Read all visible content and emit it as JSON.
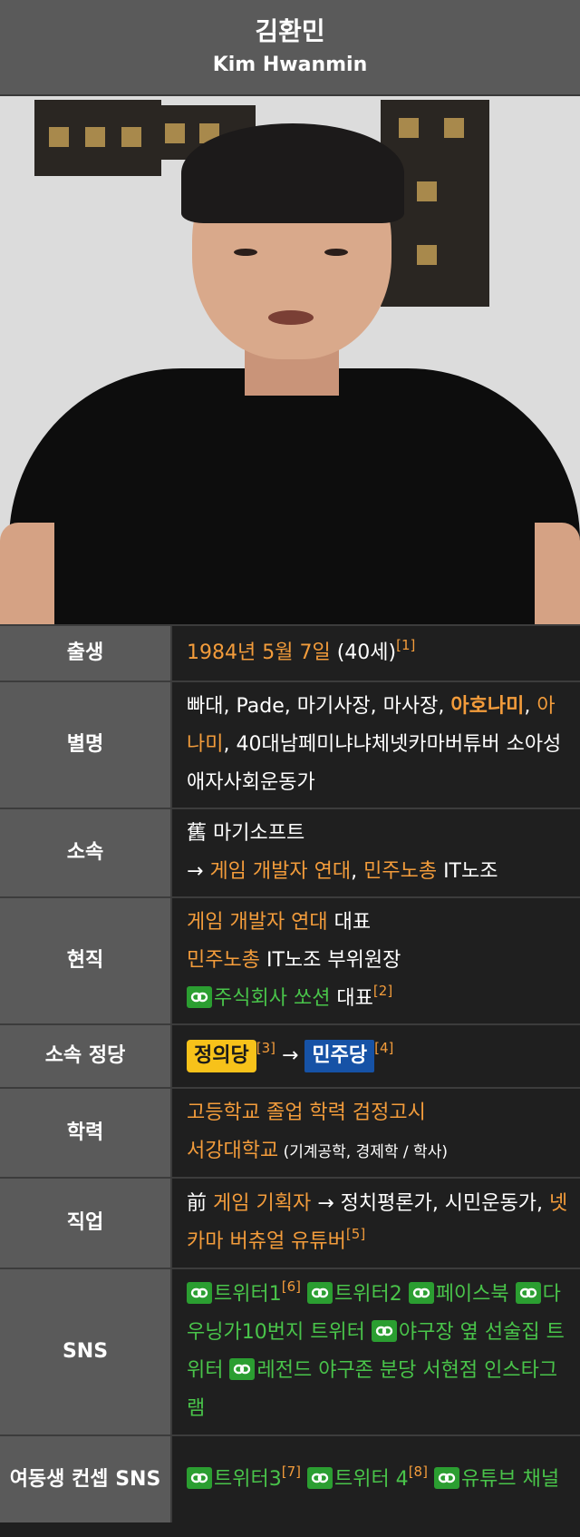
{
  "header": {
    "name_ko": "김환민",
    "name_en": "Kim Hwanmin"
  },
  "rows": {
    "birth": {
      "label": "출생",
      "date": "1984년 5월 7일",
      "age": "(40세)",
      "fn": "[1]"
    },
    "alias": {
      "label": "별명",
      "t1": "빠대, Pade, 마기사장, 마사장, ",
      "l1": "아호나미",
      "t2": ",",
      "l2": "아나미",
      "t3": ", 40대남페미냐냐체넷카마버튜버 소아성애자사회운동가"
    },
    "affil": {
      "label": "소속",
      "line1": "舊 마기소프트",
      "arrow": "→ ",
      "l1": "게임 개발자 연대",
      "sep": ", ",
      "l2": "민주노총",
      "t2": " IT노조"
    },
    "current": {
      "label": "현직",
      "l1": "게임 개발자 연대",
      "t1": " 대표",
      "l2": "민주노총",
      "t2": " IT노조 부위원장",
      "l3": "주식회사 쏘션",
      "t3": " 대표",
      "fn": "[2]"
    },
    "party": {
      "label": "소속 정당",
      "p1": "정의당",
      "fn1": "[3]",
      "arrow": " → ",
      "p2": "민주당",
      "fn2": "[4]"
    },
    "edu": {
      "label": "학력",
      "l1": "고등학교 졸업 학력 검정고시",
      "l2": "서강대학교",
      "t2": " (기계공학, 경제학 / 학사)"
    },
    "job": {
      "label": "직업",
      "t1": "前 ",
      "l1": "게임 기획자",
      "t2": " → 정치평론가, 시민운동가, ",
      "l2": "넷카마 버츄얼 유튜버",
      "fn": "[5]"
    },
    "sns": {
      "label": "SNS",
      "links": [
        "트위터1",
        "트위터2",
        "페이스북",
        "다우닝가10번지 트위터",
        "야구장 옆 선술집 트위터",
        "레전드 야구존 분당 서현점 인스타그램"
      ],
      "fn1": "[6]"
    },
    "sns2": {
      "label": "여동생 컨셉 SNS",
      "links": [
        "트위터3",
        "트위터 4",
        "유튜브 채널"
      ],
      "fn1": "[7]",
      "fn2": "[8]"
    }
  },
  "colors": {
    "header_bg": "#5a5a5a",
    "label_bg": "#5a5a5a",
    "value_bg": "#1f1f1f",
    "link_orange": "#f39c3b",
    "link_green": "#49c44a",
    "jp_yellow": "#f7c21a",
    "dp_blue": "#1652a6"
  },
  "icons": {
    "link": "link-icon"
  }
}
